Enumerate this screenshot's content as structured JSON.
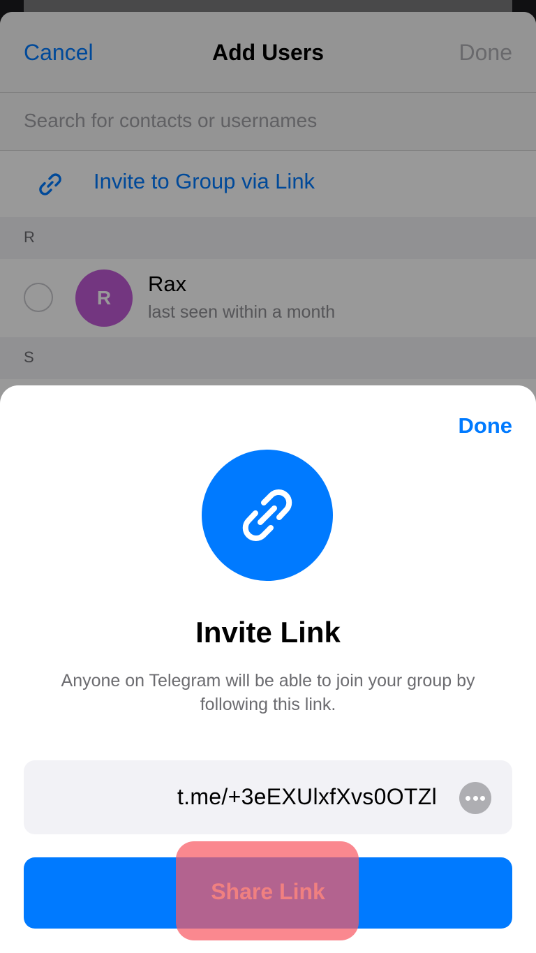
{
  "add_users": {
    "cancel_label": "Cancel",
    "title": "Add Users",
    "done_label": "Done",
    "search_placeholder": "Search for contacts or usernames",
    "invite_via_link_label": "Invite to Group via Link",
    "sections": [
      {
        "letter": "R"
      },
      {
        "letter": "S"
      }
    ],
    "contacts": [
      {
        "name": "Rax",
        "status": "last seen within a month",
        "initial": "R",
        "avatar_color": "#c05ad6"
      }
    ]
  },
  "invite_sheet": {
    "done_label": "Done",
    "title": "Invite Link",
    "description": "Anyone on Telegram will be able to join your group by following this link.",
    "link": "t.me/+3eEXUlxfXvs0OTZl",
    "share_label": "Share Link",
    "icon": "link-icon",
    "accent_color": "#007aff"
  }
}
